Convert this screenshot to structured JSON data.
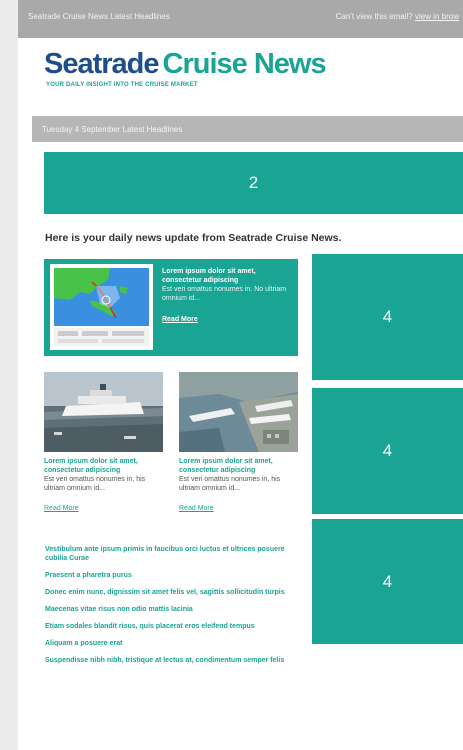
{
  "topbar": {
    "left": "Seatrade Cruise News Latest Headlines",
    "right_prefix": "Can't view this email?",
    "right_link": "view in brow"
  },
  "logo": {
    "part1": "Seatrade",
    "part2": "Cruise News"
  },
  "tagline": "YOUR DAILY INSIGHT INTO THE CRUISE MARKET",
  "datebar": "Tuesday 4 September Latest Headlines",
  "banner": "2",
  "intro": "Here is your daily news update from Seatrade Cruise News.",
  "feature": {
    "headline": "Lorem ipsum dolor sit amet, consectetur adipiscing",
    "body": "Est veri omattus nonumes in. No ultriam omnium id...",
    "more": "Read More"
  },
  "stories": [
    {
      "title": "Lorem ipsum dolor sit amet, consectetur adipiscing",
      "body": "Est veri omattus nonumes in, his ultriam omnium id...",
      "more": "Read More"
    },
    {
      "title": "Lorem ipsum dolor sit amet, consectetur adipiscing",
      "body": "Est veri omattus nonumes in, his ultriam omnium id...",
      "more": "Read More"
    }
  ],
  "side_boxes": [
    "4",
    "4",
    "4"
  ],
  "links": [
    "Vestibulum ante ipsum primis in faucibus orci luctus et ultrices posuere cubilia Curae",
    "Praesent a pharetra purus",
    "Donec enim nunc, dignissim sit amet felis vel, sagittis sollicitudin turpis",
    "Maecenas vitae risus non odio mattis lacinia",
    "Etiam sodales blandit risus, quis placerat eros eleifend tempus",
    "Aliquam a posuere erat",
    "Suspendisse nibh nibh, tristique at lectus at, condimentum semper felis"
  ],
  "colors": {
    "teal": "#1aa494",
    "navy": "#1d4e89",
    "grey_bar": "#a9a9a9"
  }
}
